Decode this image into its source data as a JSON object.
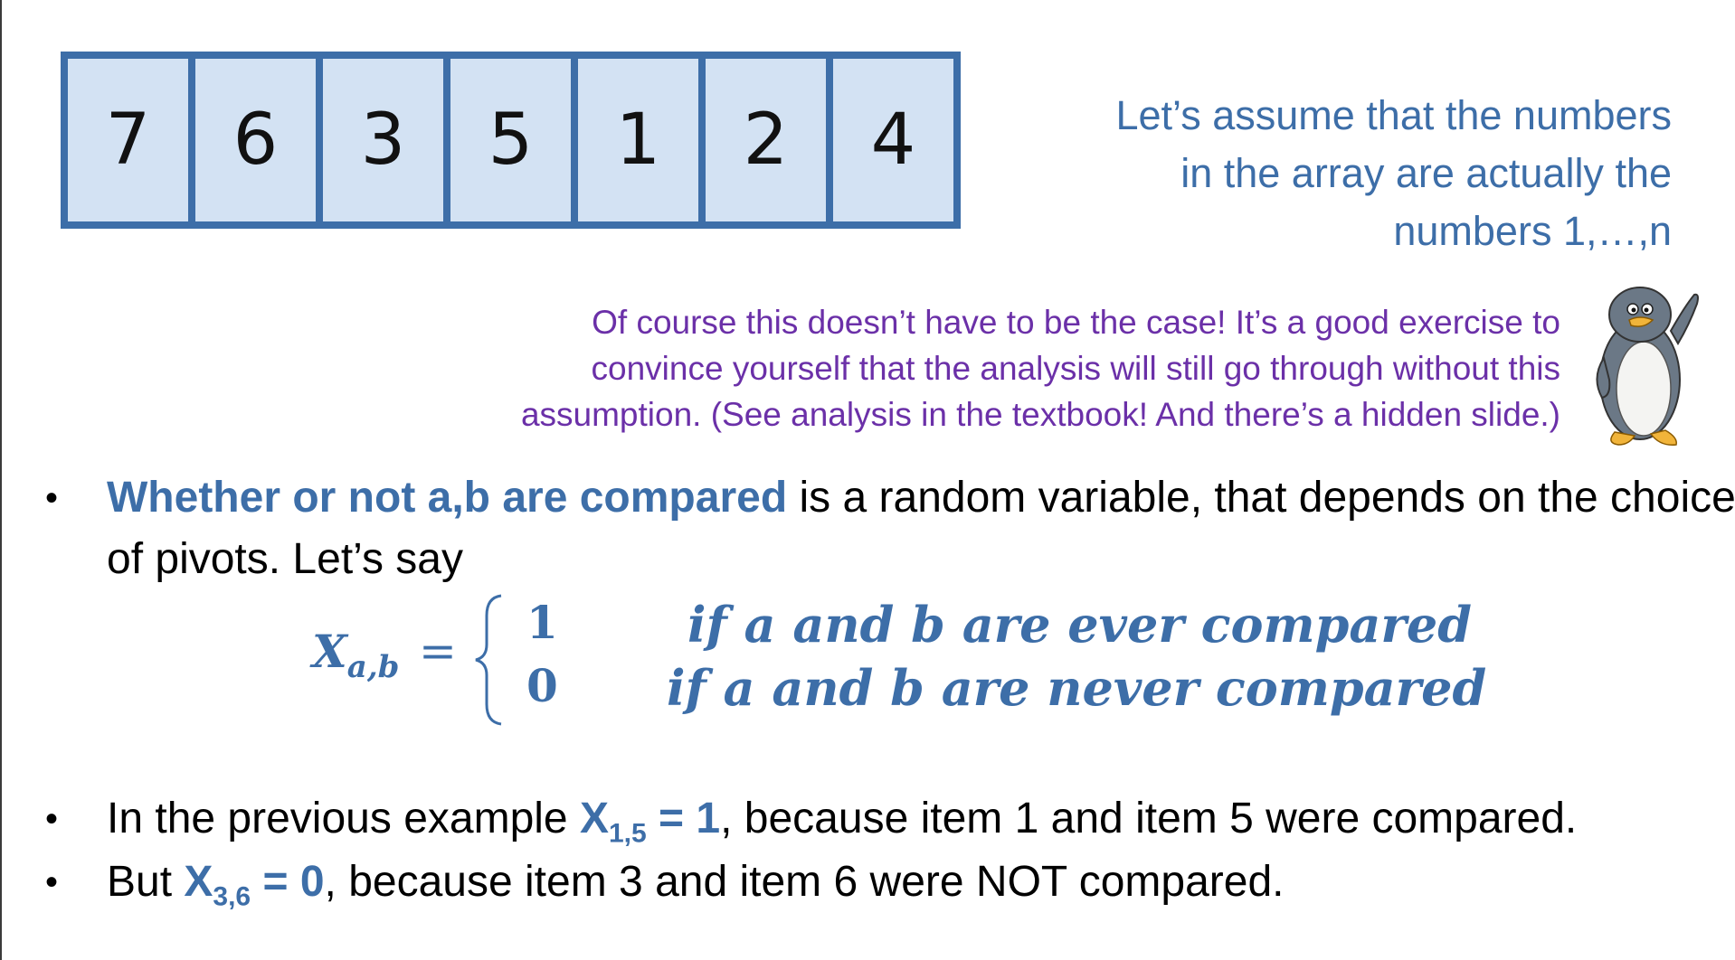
{
  "array": {
    "cells": [
      "7",
      "6",
      "3",
      "5",
      "1",
      "2",
      "4"
    ]
  },
  "note_blue": {
    "line1": "Let’s assume that the numbers",
    "line2": "in the array are actually the",
    "line3": "numbers 1,…,n"
  },
  "note_purple": {
    "line1": "Of course this doesn’t have to be the case!  It’s a good exercise to",
    "line2": "convince yourself that the analysis will still go through without this",
    "line3": "assumption. (See analysis in the textbook!  And there’s a hidden slide.)"
  },
  "bullet_symbol": "•",
  "bullet1": {
    "highlight": "Whether or not a,b are compared",
    "rest": " is a random variable, that depends on the choice of pivots.  Let’s say"
  },
  "formula": {
    "lhs_var": "X",
    "lhs_sub": "a,b",
    "equals": "=",
    "value_1": "1",
    "case_1": "if a and b are ever compared",
    "value_0": "0",
    "case_0": "if a and b are never compared"
  },
  "bullet2": {
    "pre": "In the previous example ",
    "var": "X",
    "sub": "1,5",
    "val": " = 1",
    "post": ", because item 1 and item 5 were compared."
  },
  "bullet3": {
    "pre": "But ",
    "var": "X",
    "sub": "3,6",
    "val": " = 0",
    "post": ", because item 3 and item 6 were NOT compared."
  },
  "colors": {
    "accent_blue": "#3d6ea8",
    "cell_fill": "#d3e2f3",
    "note_purple": "#6b30a8"
  },
  "icons": {
    "mascot": "penguin-icon"
  }
}
